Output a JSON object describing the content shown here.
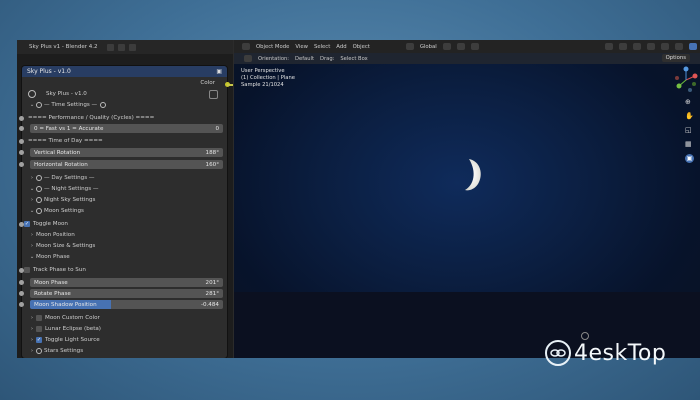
{
  "window": {
    "title": "Sky Plus v1 - Blender 4.2"
  },
  "node": {
    "header": "Sky Plus - v1.0",
    "color_output": "Color",
    "group_name": "Sky Plus - v1.0",
    "rows": {
      "time_settings": "— Time Settings —",
      "perf_header": "==== Performance / Quality (Cycles) ====",
      "fast_accurate_label": "0 = Fast vs 1 = Accurate",
      "fast_accurate_value": "0",
      "time_of_day": "==== Time of Day ====",
      "vertical_rotation_label": "Vertical Rotation",
      "vertical_rotation_value": "188°",
      "horizontal_rotation_label": "Horizontal Rotation",
      "horizontal_rotation_value": "160°",
      "day_settings": "— Day Settings —",
      "night_settings": "— Night Settings —",
      "night_sky_settings": "Night Sky Settings",
      "moon_settings": "Moon Settings",
      "toggle_moon": "Toggle Moon",
      "moon_position": "Moon Position",
      "moon_size": "Moon Size & Settings",
      "moon_phase_section": "Moon Phase",
      "track_phase": "Track Phase to Sun",
      "moon_phase_label": "Moon Phase",
      "moon_phase_value": "201°",
      "rotate_phase_label": "Rotate Phase",
      "rotate_phase_value": "281°",
      "moon_shadow_label": "Moon Shadow Position",
      "moon_shadow_value": "-0.484",
      "moon_custom_color": "Moon Custom Color",
      "lunar_eclipse": "Lunar Eclipse (beta)",
      "toggle_light": "Toggle Light Source",
      "stars_settings": "Stars Settings"
    }
  },
  "viewport": {
    "header": {
      "mode": "Object Mode",
      "menus": [
        "View",
        "Select",
        "Add",
        "Object"
      ],
      "orientation": "Global"
    },
    "subheader": {
      "orientation_label": "Orientation:",
      "orientation_value": "Default",
      "drag_label": "Drag:",
      "drag_value": "Select Box"
    },
    "overlay_lines": [
      "User Perspective",
      "(1) Collection | Plane",
      "Sample 21/1024"
    ],
    "options": "Options"
  },
  "watermark": {
    "text": "4eskTop"
  },
  "colors": {
    "accent": "#4772b3",
    "node_header": "#283d63",
    "socket_yellow": "#c7c729"
  }
}
